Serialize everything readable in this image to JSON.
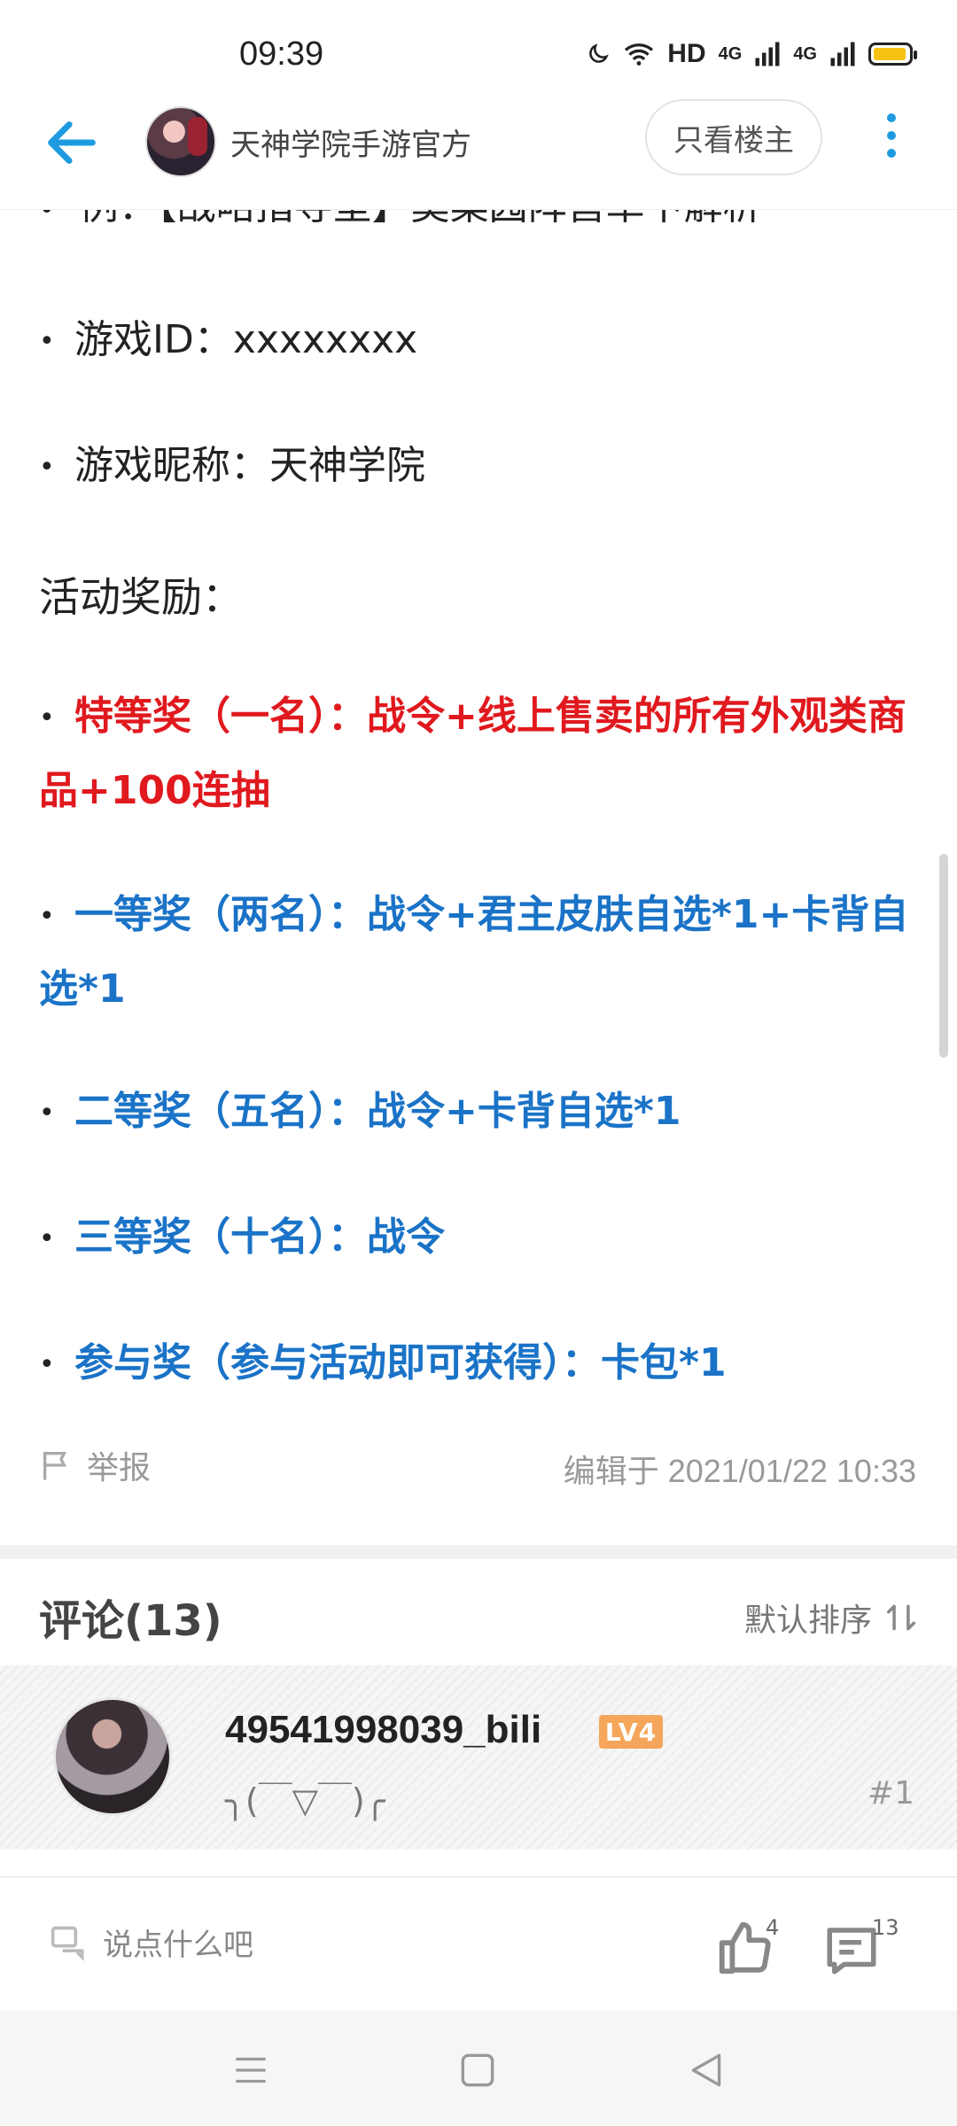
{
  "status_bar": {
    "time": "09:39",
    "network_label": "HD",
    "signal1": "4G",
    "signal2": "4G"
  },
  "header": {
    "title": "天神学院手游官方",
    "only_op_label": "只看楼主"
  },
  "post": {
    "clipped_line": "例：【战略指导室】莫桑园阵营卓卞解析",
    "game_id_line": "游戏ID：xxxxxxxx",
    "nickname_line": "游戏昵称：天神学院",
    "rewards_title": "活动奖励：",
    "prizes": [
      {
        "text": "特等奖（一名）：战令+线上售卖的所有外观类商品+100连抽",
        "color": "#e0191e"
      },
      {
        "text": "一等奖（两名）：战令+君主皮肤自选*1+卡背自选*1",
        "color": "#1a73c7"
      },
      {
        "text": "二等奖（五名）：战令+卡背自选*1",
        "color": "#1a73c7"
      },
      {
        "text": "三等奖（十名）：战令",
        "color": "#1a73c7"
      },
      {
        "text": "参与奖（参与活动即可获得）：卡包*1",
        "color": "#1a73c7"
      }
    ],
    "report_label": "举报",
    "edit_time": "编辑于 2021/01/22 10:33"
  },
  "comments": {
    "title": "评论(13)",
    "sort_label": "默认排序",
    "items": [
      {
        "user": "49541998039_bili",
        "level": "LV4",
        "text": "╮(￣▽￣)╭",
        "floor": "#1"
      }
    ]
  },
  "input_bar": {
    "placeholder": "说点什么吧",
    "like_count": "4",
    "comment_count": "13"
  },
  "colors": {
    "accent": "#1e9be0",
    "prize_red": "#e0191e",
    "prize_blue": "#1a73c7",
    "level_badge": "#f5a65a"
  }
}
